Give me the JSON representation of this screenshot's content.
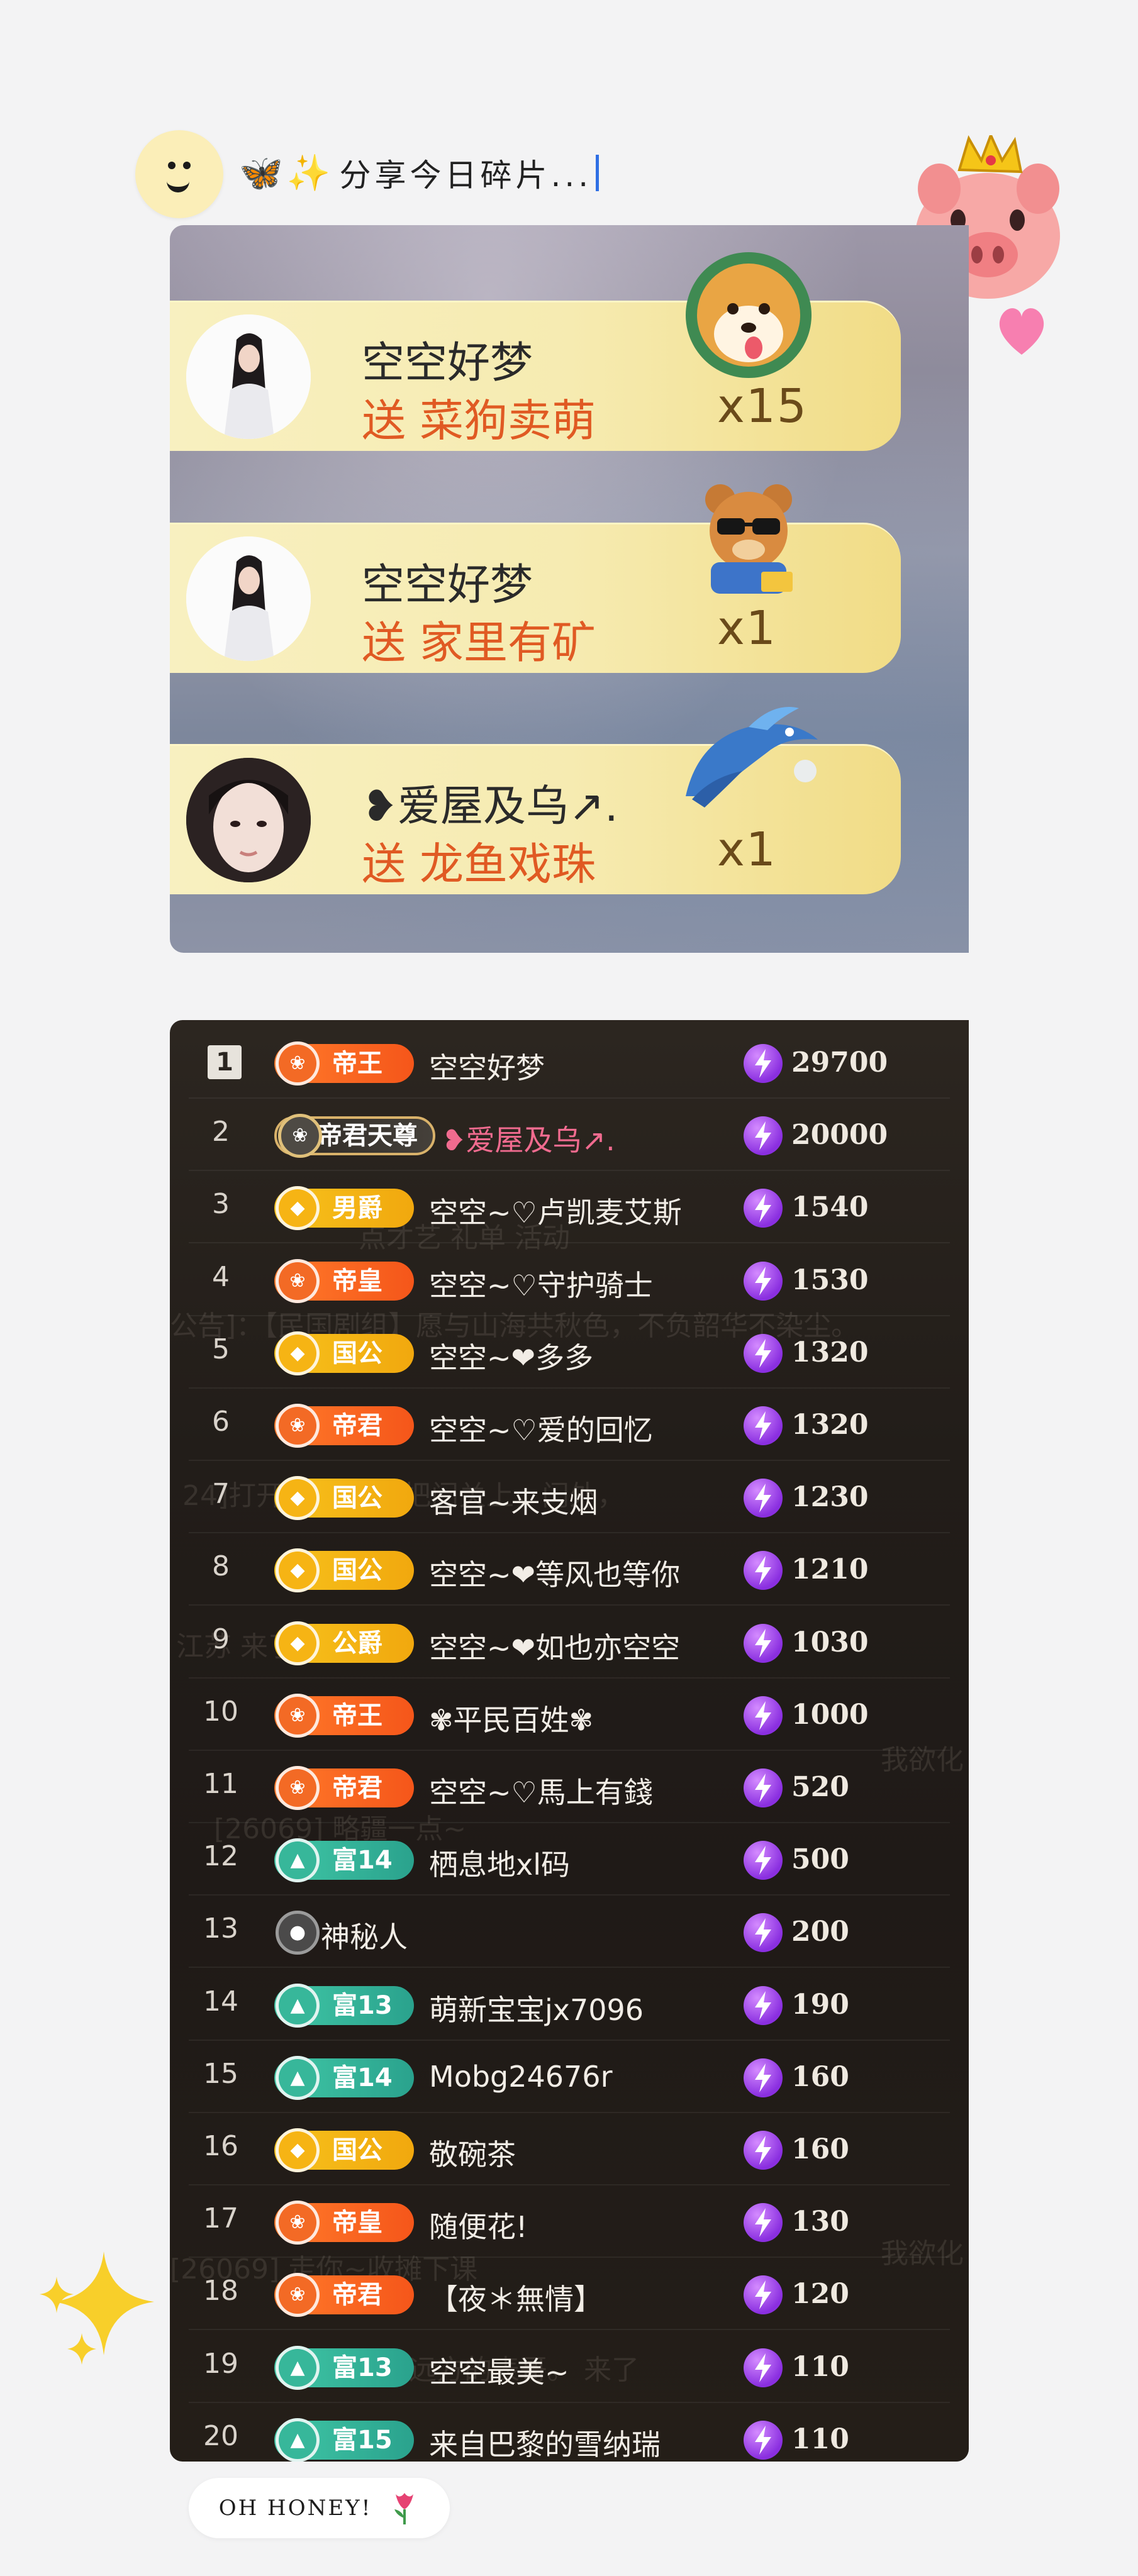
{
  "header": {
    "caption_text": "分享今日碎片...",
    "caption_emoji": "🦋✨"
  },
  "gift_panel": {
    "send_word": "送",
    "rows": [
      {
        "sender": "空空好梦",
        "gift": "菜狗卖萌",
        "count": "x15"
      },
      {
        "sender": "空空好梦",
        "gift": "家里有矿",
        "count": "x1"
      },
      {
        "sender": "❥爱屋及乌↗.",
        "gift": "龙鱼戏珠",
        "count": "x1"
      }
    ]
  },
  "leaderboard": {
    "ghost_text": {
      "tabs": "点才艺    礼单    活动",
      "notice": "公告]：【民国剧组】愿与山海共秋色，不负韶华不染尘。",
      "l1": "24]打开    来啦？快把门关上，门外，",
      "l2": "江苏    来了",
      "l3": "我欲化",
      "l4": "[26069]    略疆一点~",
      "l5": "我欲化",
      "l6": "[26069]    走你~收摊下课",
      "l7": "远方的表哥。 来了"
    },
    "rows": [
      {
        "rank": "1",
        "badge": "帝王",
        "style": "orange",
        "name": "空空好梦",
        "score": "29700"
      },
      {
        "rank": "2",
        "badge": "帝君天尊",
        "style": "dark",
        "name": "❥爱屋及乌↗.",
        "score": "20000"
      },
      {
        "rank": "3",
        "badge": "男爵",
        "style": "yellow",
        "name": "空空~♡卢凯麦艾斯",
        "score": "1540"
      },
      {
        "rank": "4",
        "badge": "帝皇",
        "style": "orange",
        "name": "空空~♡守护骑士",
        "score": "1530"
      },
      {
        "rank": "5",
        "badge": "国公",
        "style": "yellow",
        "name": "空空~❤多多",
        "score": "1320"
      },
      {
        "rank": "6",
        "badge": "帝君",
        "style": "orange",
        "name": "空空~♡爱的回忆",
        "score": "1320"
      },
      {
        "rank": "7",
        "badge": "国公",
        "style": "yellow",
        "name": "客官~来支烟",
        "score": "1230"
      },
      {
        "rank": "8",
        "badge": "国公",
        "style": "yellow",
        "name": "空空~❤等风也等你",
        "score": "1210"
      },
      {
        "rank": "9",
        "badge": "公爵",
        "style": "yellow",
        "name": "空空~❤如也亦空空",
        "score": "1030"
      },
      {
        "rank": "10",
        "badge": "帝王",
        "style": "orange",
        "name": "✾平民百姓✾",
        "score": "1000"
      },
      {
        "rank": "11",
        "badge": "帝君",
        "style": "orange",
        "name": "空空~♡馬上有錢",
        "score": "520"
      },
      {
        "rank": "12",
        "badge": "富14",
        "style": "teal",
        "name": "栖息地xl码",
        "score": "500"
      },
      {
        "rank": "13",
        "badge": "",
        "style": "purple",
        "name": "神秘人",
        "score": "200"
      },
      {
        "rank": "14",
        "badge": "富13",
        "style": "teal",
        "name": "萌新宝宝jx7096",
        "score": "190"
      },
      {
        "rank": "15",
        "badge": "富14",
        "style": "teal",
        "name": "Mobg24676r",
        "score": "160"
      },
      {
        "rank": "16",
        "badge": "国公",
        "style": "yellow",
        "name": "敬碗茶",
        "score": "160"
      },
      {
        "rank": "17",
        "badge": "帝皇",
        "style": "orange",
        "name": "随便花!",
        "score": "130"
      },
      {
        "rank": "18",
        "badge": "帝君",
        "style": "orange",
        "name": "【夜＊無情】",
        "score": "120"
      },
      {
        "rank": "19",
        "badge": "富13",
        "style": "teal",
        "name": "空空最美~",
        "score": "110"
      },
      {
        "rank": "20",
        "badge": "富15",
        "style": "teal",
        "name": "来自巴黎的雪纳瑞",
        "score": "110"
      }
    ]
  },
  "footer": {
    "honey_label": "OH HONEY!"
  },
  "colors": {
    "background": "#f3f3f4",
    "gift_row": "#f6ebb1",
    "gift_name": "#e05a23",
    "board_bg": "#221d19",
    "badge_orange": "#f5561a",
    "badge_yellow": "#f1a80e",
    "badge_teal": "#2aa28d",
    "bolt_purple": "#8a2fe0"
  }
}
